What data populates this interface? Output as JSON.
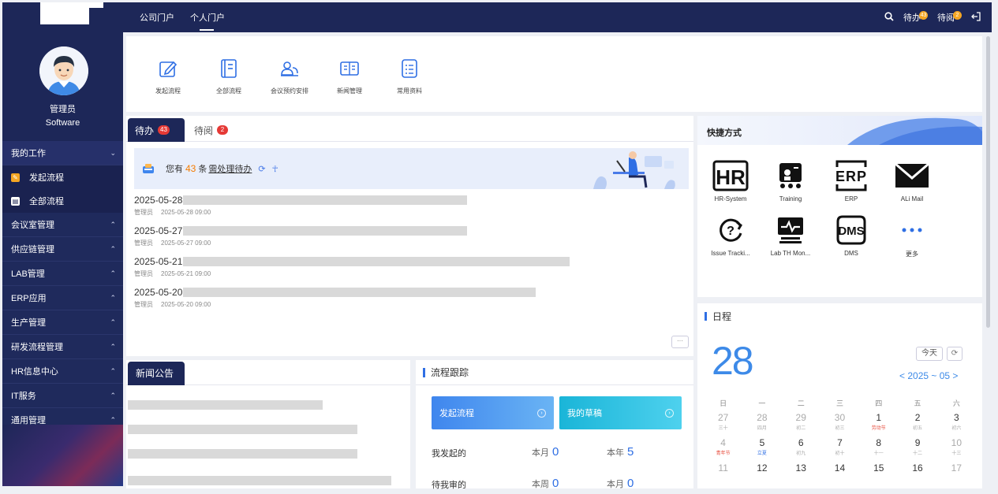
{
  "colors": {
    "sidebar": "#1d2758",
    "accent": "#2f6fe4",
    "badge": "#e53935",
    "highlight": "#f57c00"
  },
  "user": {
    "name": "管理员",
    "dept": "Software"
  },
  "sidebar": {
    "groups": [
      {
        "label": "我的工作",
        "expanded": true,
        "children": [
          {
            "label": "发起流程",
            "icon": "edit-icon"
          },
          {
            "label": "全部流程",
            "icon": "document-icon"
          }
        ]
      },
      {
        "label": "会议室管理"
      },
      {
        "label": "供应链管理"
      },
      {
        "label": "LAB管理"
      },
      {
        "label": "ERP应用"
      },
      {
        "label": "生产管理"
      },
      {
        "label": "研发流程管理"
      },
      {
        "label": "HR信息中心"
      },
      {
        "label": "IT服务"
      },
      {
        "label": "通用管理"
      }
    ]
  },
  "topbar": {
    "nav": [
      "公司门户",
      "个人门户"
    ],
    "active_nav": "个人门户",
    "todo_label": "待办",
    "todo_count": "43",
    "read_label": "待阅",
    "read_count": "2"
  },
  "quick_apps": [
    {
      "label": "发起流程",
      "icon": "edit-icon"
    },
    {
      "label": "全部流程",
      "icon": "list-icon"
    },
    {
      "label": "会议预约安排",
      "icon": "meeting-icon"
    },
    {
      "label": "新闻管理",
      "icon": "news-icon"
    },
    {
      "label": "常用资料",
      "icon": "file-icon"
    }
  ],
  "todo_panel": {
    "tab_todo": "待办",
    "tab_todo_count": "43",
    "tab_read": "待阅",
    "tab_read_count": "2",
    "notice_prefix": "您有",
    "notice_count": "43",
    "notice_unit": "条",
    "notice_link": "需处理待办",
    "items": [
      {
        "date": "2025-05-28",
        "author": "管理员",
        "time": "2025-05-28 09:00"
      },
      {
        "date": "2025-05-27",
        "author": "管理员",
        "time": "2025-05-27 09:00"
      },
      {
        "date": "2025-05-21",
        "author": "管理员",
        "time": "2025-05-21 09:00"
      },
      {
        "date": "2025-05-20",
        "author": "管理员",
        "time": "2025-05-20 09:00"
      }
    ],
    "more": "···"
  },
  "news": {
    "title": "新闻公告"
  },
  "process": {
    "title": "流程跟踪",
    "btn_start": "发起流程",
    "btn_draft": "我的草稿",
    "rows": [
      {
        "label": "我发起的",
        "month_label": "本月",
        "month_value": "0",
        "year_label": "本年",
        "year_value": "5"
      },
      {
        "label": "待我审的",
        "month_label": "本周",
        "month_value": "0",
        "year_label": "本月",
        "year_value": "0"
      }
    ]
  },
  "shortcuts": {
    "title": "快捷方式",
    "items": [
      {
        "label": "HR-System",
        "icon": "hr-icon"
      },
      {
        "label": "Training",
        "icon": "training-icon"
      },
      {
        "label": "ERP",
        "icon": "erp-icon"
      },
      {
        "label": "ALi Mail",
        "icon": "mail-icon"
      },
      {
        "label": "Issue Tracki...",
        "icon": "question-icon"
      },
      {
        "label": "Lab TH Mon...",
        "icon": "monitor-icon"
      },
      {
        "label": "DMS",
        "icon": "dms-icon"
      },
      {
        "label": "更多",
        "icon": "more-icon"
      }
    ]
  },
  "schedule": {
    "title": "日程",
    "day": "28",
    "today": "今天",
    "year_month": "< 2025 ~ 05 >",
    "weekdays": [
      "日",
      "一",
      "二",
      "三",
      "四",
      "五",
      "六"
    ],
    "weeks": [
      [
        {
          "d": "27",
          "l": "三十",
          "o": true
        },
        {
          "d": "28",
          "l": "四月",
          "o": true
        },
        {
          "d": "29",
          "l": "初二",
          "o": true
        },
        {
          "d": "30",
          "l": "初三",
          "o": true
        },
        {
          "d": "1",
          "l": "劳动节",
          "h": true
        },
        {
          "d": "2",
          "l": "初五"
        },
        {
          "d": "3",
          "l": "初六"
        }
      ],
      [
        {
          "d": "4",
          "l": "青年节",
          "h": true,
          "o": true
        },
        {
          "d": "5",
          "l": "立夏",
          "t": true
        },
        {
          "d": "6",
          "l": "初九"
        },
        {
          "d": "7",
          "l": "初十"
        },
        {
          "d": "8",
          "l": "十一"
        },
        {
          "d": "9",
          "l": "十二"
        },
        {
          "d": "10",
          "l": "十三",
          "o": true
        }
      ],
      [
        {
          "d": "11",
          "l": "",
          "o": true
        },
        {
          "d": "12",
          "l": ""
        },
        {
          "d": "13",
          "l": ""
        },
        {
          "d": "14",
          "l": ""
        },
        {
          "d": "15",
          "l": ""
        },
        {
          "d": "16",
          "l": ""
        },
        {
          "d": "17",
          "l": "",
          "o": true
        }
      ]
    ]
  }
}
